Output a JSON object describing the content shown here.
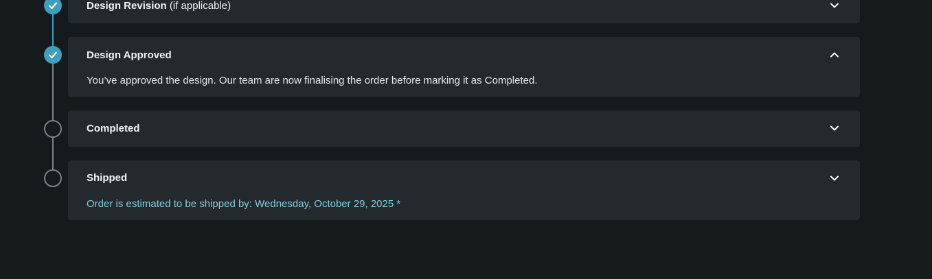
{
  "steps": [
    {
      "title": "Design Revision",
      "title_suffix": "(if applicable)",
      "status": "done",
      "expanded": false,
      "body": "",
      "chevron": "chevron-down-icon"
    },
    {
      "title": "Design Approved",
      "title_suffix": "",
      "status": "done",
      "expanded": true,
      "body": "You’ve approved the design. Our team are now finalising the order before marking it as Completed.",
      "chevron": "chevron-up-icon"
    },
    {
      "title": "Completed",
      "title_suffix": "",
      "status": "pending",
      "expanded": false,
      "body": "",
      "chevron": "chevron-down-icon"
    },
    {
      "title": "Shipped",
      "title_suffix": "",
      "status": "pending",
      "expanded": true,
      "body": "Order is estimated to be shipped by: Wednesday, October 29, 2025 *",
      "chevron": "chevron-down-icon"
    }
  ],
  "colors": {
    "background": "#151a1d",
    "card": "#24292d",
    "accent": "#3f9fbc",
    "accent_text": "#7ccfe3",
    "pending": "#7c8288"
  }
}
